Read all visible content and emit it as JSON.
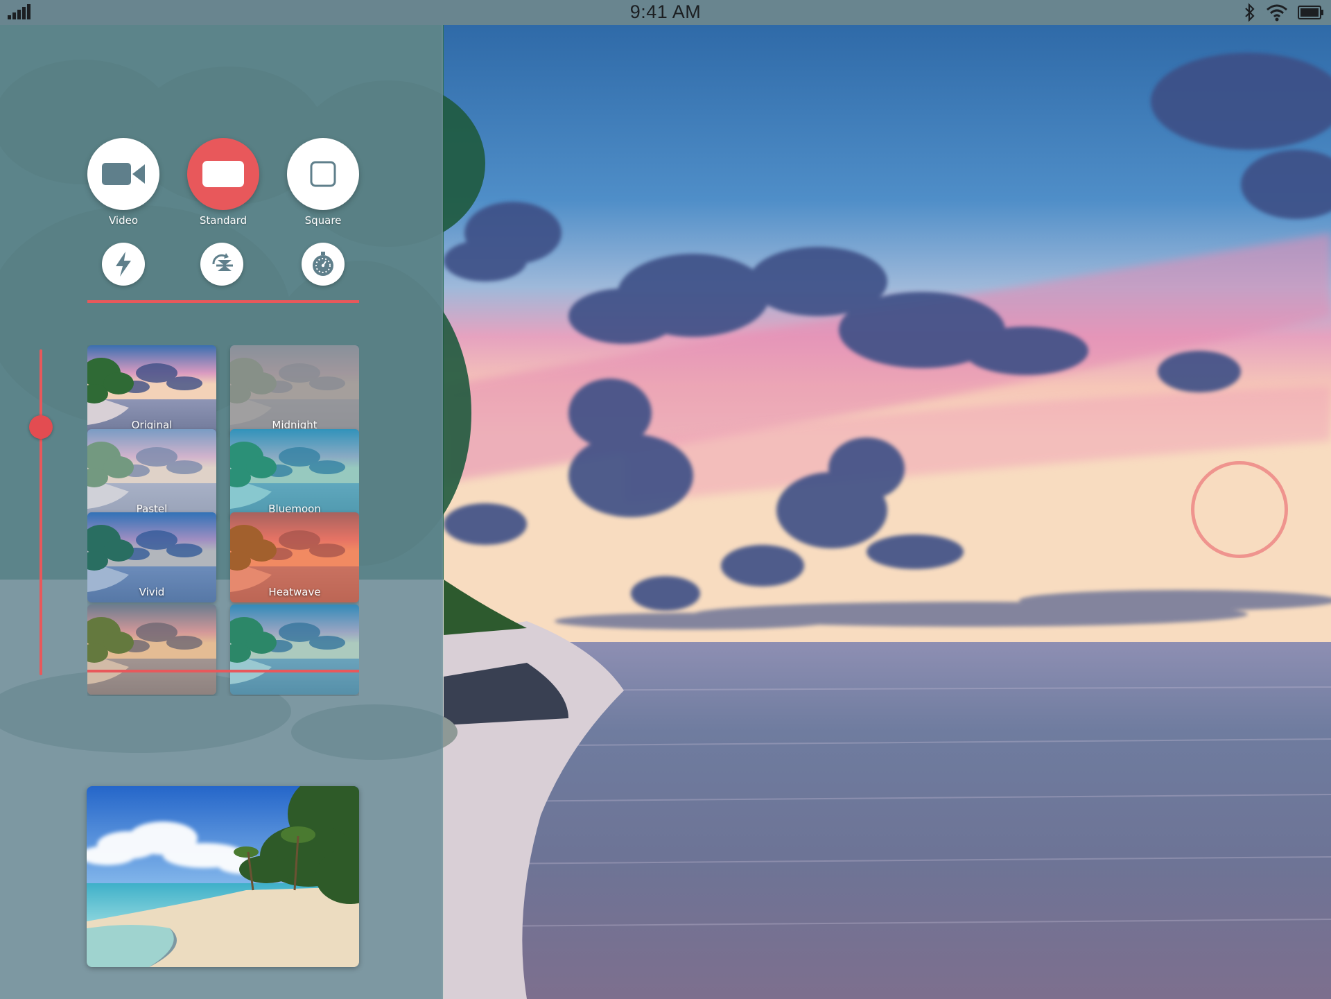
{
  "status_bar": {
    "time": "9:41 AM",
    "icons": [
      "signal-bars-icon",
      "bluetooth-icon",
      "wifi-icon",
      "battery-icon"
    ]
  },
  "modes": [
    {
      "id": "video",
      "label": "Video",
      "icon": "video-camera-icon",
      "active": false
    },
    {
      "id": "standard",
      "label": "Standard",
      "icon": "rectangle-icon",
      "active": true
    },
    {
      "id": "square",
      "label": "Square",
      "icon": "square-icon",
      "active": false
    }
  ],
  "tools": [
    {
      "id": "flash",
      "icon": "flash-icon"
    },
    {
      "id": "switch-camera",
      "icon": "switch-camera-icon"
    },
    {
      "id": "timer",
      "icon": "timer-icon"
    }
  ],
  "filter_slider": {
    "value_fraction": 0.24
  },
  "filters": [
    {
      "label": "Original"
    },
    {
      "label": "Midnight"
    },
    {
      "label": "Pastel"
    },
    {
      "label": "Bluemoon"
    },
    {
      "label": "Vivid"
    },
    {
      "label": "Heatwave"
    },
    {
      "label": ""
    },
    {
      "label": ""
    }
  ],
  "colors": {
    "accent": "#e8585b",
    "panel": "#688a96",
    "status_bar": "#69858f"
  },
  "preview": {
    "name": "last-photo-thumbnail"
  },
  "focus_indicator": {
    "name": "focus-ring"
  }
}
